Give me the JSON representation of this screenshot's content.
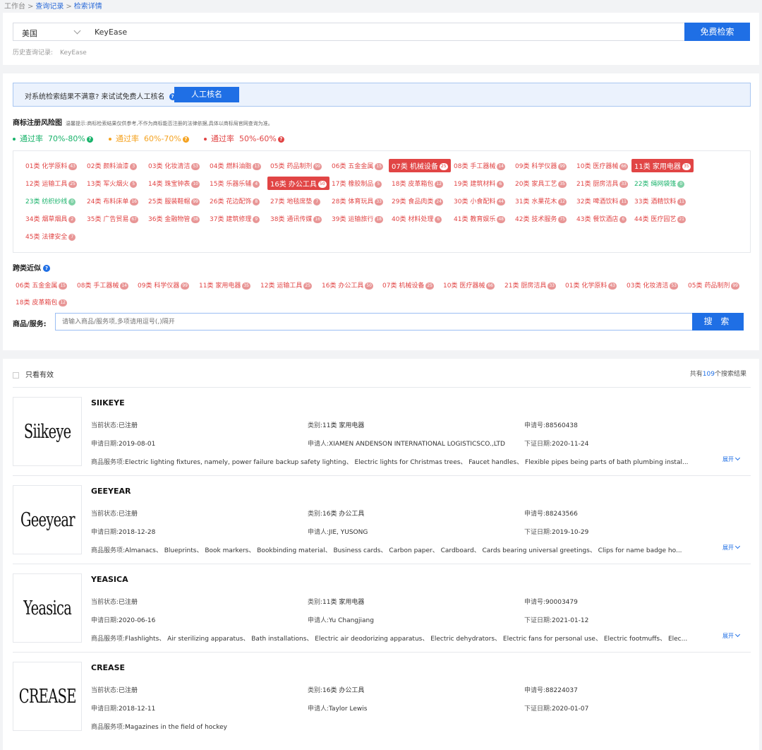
{
  "breadcrumb": {
    "home": "工作台",
    "records": "查询记录",
    "current": "检索详情",
    "separator": ">"
  },
  "search": {
    "country": "美国",
    "keyword": "KeyEase",
    "button": "免费检索",
    "history_label": "历史查询记录:",
    "history_value": "KeyEase"
  },
  "review": {
    "prompt": "对系统检索结果不满意? 来试试免费人工核名",
    "button": "人工核名"
  },
  "risk": {
    "title": "商标注册风险图",
    "tip": "温馨提示:商标检索结果仅供参考,不作为商标能否注册的法律依据,具体以商标局官网查询为准。",
    "legend": [
      {
        "label": "通过率",
        "range": "70%-80%",
        "color": "#19b36b"
      },
      {
        "label": "通过率",
        "range": "60%-70%",
        "color": "#f5a321"
      },
      {
        "label": "通过率",
        "range": "50%-60%",
        "color": "#e14545"
      }
    ],
    "classes": [
      {
        "label": "01类 化学原料",
        "count": "43",
        "status": "red"
      },
      {
        "label": "02类 颜料油漆",
        "count": "3",
        "status": "red"
      },
      {
        "label": "03类 化妆清洁",
        "count": "53",
        "status": "red"
      },
      {
        "label": "04类 燃料油脂",
        "count": "13",
        "status": "red"
      },
      {
        "label": "05类 药品制剂",
        "count": "99",
        "status": "red"
      },
      {
        "label": "06类 五金金属",
        "count": "15",
        "status": "red"
      },
      {
        "label": "07类 机械设备",
        "count": "25",
        "status": "highlight"
      },
      {
        "label": "08类 手工器械",
        "count": "14",
        "status": "red"
      },
      {
        "label": "09类 科学仪器",
        "count": "99",
        "status": "red"
      },
      {
        "label": "10类 医疗器械",
        "count": "66",
        "status": "red"
      },
      {
        "label": "11类 家用电器",
        "count": "35",
        "status": "highlight"
      },
      {
        "label": "12类 运输工具",
        "count": "25",
        "status": "red"
      },
      {
        "label": "13类 军火烟火",
        "count": "5",
        "status": "red"
      },
      {
        "label": "14类 珠宝钟表",
        "count": "10",
        "status": "red"
      },
      {
        "label": "15类 乐器乐辅",
        "count": "4",
        "status": "red"
      },
      {
        "label": "16类 办公工具",
        "count": "50",
        "status": "highlight"
      },
      {
        "label": "17类 橡胶制品",
        "count": "5",
        "status": "red"
      },
      {
        "label": "18类 皮革箱包",
        "count": "12",
        "status": "red"
      },
      {
        "label": "19类 建筑材料",
        "count": "6",
        "status": "red"
      },
      {
        "label": "20类 家具工艺",
        "count": "35",
        "status": "red"
      },
      {
        "label": "21类 厨房洁具",
        "count": "33",
        "status": "red"
      },
      {
        "label": "22类 绳网袋篷",
        "count": "0",
        "status": "green"
      },
      {
        "label": "23类 纺织纱线",
        "count": "0",
        "status": "green"
      },
      {
        "label": "24类 布料床单",
        "count": "16",
        "status": "red"
      },
      {
        "label": "25类 服装鞋帽",
        "count": "99",
        "status": "red"
      },
      {
        "label": "26类 花边配饰",
        "count": "8",
        "status": "red"
      },
      {
        "label": "27类 地毯席垫",
        "count": "7",
        "status": "red"
      },
      {
        "label": "28类 体育玩具",
        "count": "33",
        "status": "red"
      },
      {
        "label": "29类 食品肉类",
        "count": "24",
        "status": "red"
      },
      {
        "label": "30类 小食配料",
        "count": "44",
        "status": "red"
      },
      {
        "label": "31类 水果花木",
        "count": "12",
        "status": "red"
      },
      {
        "label": "32类 啤酒饮料",
        "count": "11",
        "status": "red"
      },
      {
        "label": "33类 酒精饮料",
        "count": "11",
        "status": "red"
      },
      {
        "label": "34类 烟草烟具",
        "count": "2",
        "status": "red"
      },
      {
        "label": "35类 广告贸易",
        "count": "67",
        "status": "red"
      },
      {
        "label": "36类 金融物管",
        "count": "38",
        "status": "red"
      },
      {
        "label": "37类 建筑修理",
        "count": "9",
        "status": "red"
      },
      {
        "label": "38类 通讯传媒",
        "count": "16",
        "status": "red"
      },
      {
        "label": "39类 运输旅行",
        "count": "18",
        "status": "red"
      },
      {
        "label": "40类 材料处理",
        "count": "6",
        "status": "red"
      },
      {
        "label": "41类 教育娱乐",
        "count": "48",
        "status": "red"
      },
      {
        "label": "42类 技术服务",
        "count": "75",
        "status": "red"
      },
      {
        "label": "43类 餐饮酒店",
        "count": "6",
        "status": "red"
      },
      {
        "label": "44类 医疗园艺",
        "count": "21",
        "status": "red"
      },
      {
        "label": "45类 法律安全",
        "count": "7",
        "status": "red"
      }
    ]
  },
  "cross": {
    "title": "跨类近似",
    "items": [
      {
        "label": "06类 五金金属",
        "count": "15"
      },
      {
        "label": "08类 手工器械",
        "count": "14"
      },
      {
        "label": "09类 科学仪器",
        "count": "99"
      },
      {
        "label": "11类 家用电器",
        "count": "35"
      },
      {
        "label": "12类 运输工具",
        "count": "25"
      },
      {
        "label": "16类 办公工具",
        "count": "50"
      },
      {
        "label": "07类 机械设备",
        "count": "25"
      },
      {
        "label": "10类 医疗器械",
        "count": "66"
      },
      {
        "label": "21类 厨房洁具",
        "count": "33"
      },
      {
        "label": "01类 化学原料",
        "count": "43"
      },
      {
        "label": "03类 化妆清洁",
        "count": "53"
      },
      {
        "label": "05类 药品制剂",
        "count": "99"
      },
      {
        "label": "18类 皮革箱包",
        "count": "12"
      }
    ]
  },
  "goods": {
    "label": "商品/服务:",
    "placeholder": "请输入商品/服务项,多项请用逗号(,)隔开",
    "button": "搜 索"
  },
  "results": {
    "valid_only": "只看有效",
    "total_prefix": "共有",
    "total": "109",
    "total_suffix": "个搜索结果",
    "labels": {
      "status": "当前状态:",
      "category": "类别:",
      "reg_no": "申请号:",
      "apply_date": "申请日期:",
      "applicant": "申请人:",
      "cert_date": "下证日期:",
      "goods": "商品服务项:",
      "expand": "展开"
    },
    "items": [
      {
        "name": "SIIKEYE",
        "logo": "Siikeye",
        "status": "已注册",
        "category": "11类 家用电器",
        "reg_no": "88560438",
        "apply_date": "2019-08-01",
        "applicant": "XIAMEN ANDENSON INTERNATIONAL LOGISTICSCO.,LTD",
        "cert_date": "2020-11-24",
        "goods": "Electric lighting fixtures, namely, power failure backup safety lighting、 Electric lights for Christmas trees、 Faucet handles、 Flexible pipes being parts of bath plumbing instal...",
        "expandable": true
      },
      {
        "name": "GEEYEAR",
        "logo": "Geeyear",
        "status": "已注册",
        "category": "16类 办公工具",
        "reg_no": "88243566",
        "apply_date": "2018-12-28",
        "applicant": "JIE, YUSONG",
        "cert_date": "2019-10-29",
        "goods": "Almanacs、 Blueprints、 Book markers、 Bookbinding material、 Business cards、 Carbon paper、 Cardboard、 Cards bearing universal greetings、 Clips for name badge ho...",
        "expandable": true
      },
      {
        "name": "YEASICA",
        "logo": "Yeasica",
        "status": "已注册",
        "category": "11类 家用电器",
        "reg_no": "90003479",
        "apply_date": "2020-06-16",
        "applicant": "Yu Changjiang",
        "cert_date": "2021-01-12",
        "goods": "Flashlights、 Air sterilizing apparatus、 Bath installations、 Electric air deodorizing apparatus、 Electric dehydrators、 Electric fans for personal use、 Electric footmuffs、 Elec...",
        "expandable": true
      },
      {
        "name": "CREASE",
        "logo": "CREASE",
        "status": "已注册",
        "category": "16类 办公工具",
        "reg_no": "88224037",
        "apply_date": "2018-12-11",
        "applicant": "Taylor Lewis",
        "cert_date": "2020-01-07",
        "goods": "Magazines in the field of hockey",
        "expandable": false
      }
    ]
  }
}
